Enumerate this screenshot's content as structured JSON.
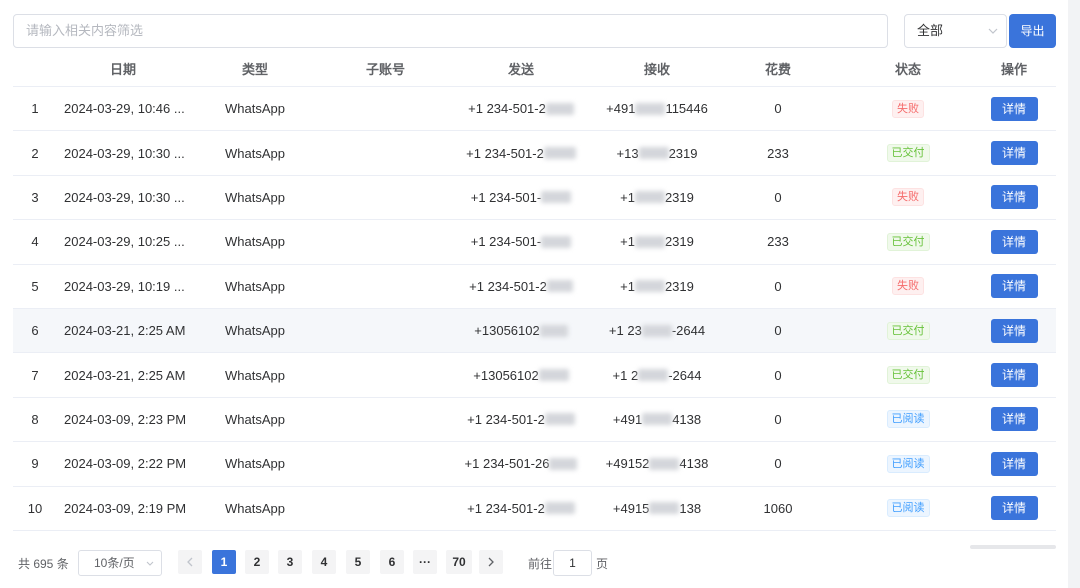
{
  "toolbar": {
    "search_placeholder": "请输入相关内容筛选",
    "filter_value": "全部",
    "export_label": "导出"
  },
  "table": {
    "headers": {
      "date": "日期",
      "type": "类型",
      "subaccount": "子账号",
      "send": "发送",
      "receive": "接收",
      "fee": "花费",
      "status": "状态",
      "action": "操作"
    },
    "rows": [
      {
        "index": "1",
        "date": "2024-03-29, 10:46 ...",
        "type": "WhatsApp",
        "subaccount": "",
        "send": "+1 234-501-2",
        "receive_prefix": "+491",
        "receive_suffix": "115446",
        "fee": "0",
        "status": "失败",
        "status_kind": "fail",
        "action": "详情"
      },
      {
        "index": "2",
        "date": "2024-03-29, 10:30 ...",
        "type": "WhatsApp",
        "subaccount": "",
        "send": "+1 234-501-2",
        "receive_prefix": "+13",
        "receive_suffix": "2319",
        "fee": "233",
        "status": "已交付",
        "status_kind": "paid",
        "action": "详情"
      },
      {
        "index": "3",
        "date": "2024-03-29, 10:30 ...",
        "type": "WhatsApp",
        "subaccount": "",
        "send": "+1 234-501-",
        "receive_prefix": "+1",
        "receive_suffix": "2319",
        "fee": "0",
        "status": "失败",
        "status_kind": "fail",
        "action": "详情"
      },
      {
        "index": "4",
        "date": "2024-03-29, 10:25 ...",
        "type": "WhatsApp",
        "subaccount": "",
        "send": "+1 234-501-",
        "receive_prefix": "+1",
        "receive_suffix": "2319",
        "fee": "233",
        "status": "已交付",
        "status_kind": "paid",
        "action": "详情"
      },
      {
        "index": "5",
        "date": "2024-03-29, 10:19 ...",
        "type": "WhatsApp",
        "subaccount": "",
        "send": "+1 234-501-2",
        "receive_prefix": "+1",
        "receive_suffix": "2319",
        "fee": "0",
        "status": "失败",
        "status_kind": "fail",
        "action": "详情"
      },
      {
        "index": "6",
        "date": "2024-03-21, 2:25 AM",
        "type": "WhatsApp",
        "subaccount": "",
        "send": "+13056102",
        "receive_prefix": "+1 23",
        "receive_suffix": "-2644",
        "fee": "0",
        "status": "已交付",
        "status_kind": "paid",
        "action": "详情"
      },
      {
        "index": "7",
        "date": "2024-03-21, 2:25 AM",
        "type": "WhatsApp",
        "subaccount": "",
        "send": "+13056102",
        "receive_prefix": "+1 2",
        "receive_suffix": "-2644",
        "fee": "0",
        "status": "已交付",
        "status_kind": "paid",
        "action": "详情"
      },
      {
        "index": "8",
        "date": "2024-03-09, 2:23 PM",
        "type": "WhatsApp",
        "subaccount": "",
        "send": "+1 234-501-2",
        "receive_prefix": "+491",
        "receive_suffix": "4138",
        "fee": "0",
        "status": "已阅读",
        "status_kind": "read",
        "action": "详情"
      },
      {
        "index": "9",
        "date": "2024-03-09, 2:22 PM",
        "type": "WhatsApp",
        "subaccount": "",
        "send": "+1 234-501-26",
        "receive_prefix": "+49152",
        "receive_suffix": "4138",
        "fee": "0",
        "status": "已阅读",
        "status_kind": "read",
        "action": "详情"
      },
      {
        "index": "10",
        "date": "2024-03-09, 2:19 PM",
        "type": "WhatsApp",
        "subaccount": "",
        "send": "+1 234-501-2",
        "receive_prefix": "+4915",
        "receive_suffix": "138",
        "fee": "1060",
        "status": "已阅读",
        "status_kind": "read",
        "action": "详情"
      }
    ]
  },
  "pagination": {
    "total": "共 695 条",
    "page_size": "10条/页",
    "pages": [
      "1",
      "2",
      "3",
      "4",
      "5",
      "6",
      "···",
      "70"
    ],
    "current": 1,
    "prev_icon": "chevron-left-icon",
    "next_icon": "chevron-right-icon",
    "goto_label": "前往",
    "goto_value": "1",
    "goto_suffix": "页"
  },
  "colors": {
    "primary": "#3a74db",
    "fail": "#f56c6c",
    "paid": "#67c23a",
    "read": "#409eff"
  }
}
